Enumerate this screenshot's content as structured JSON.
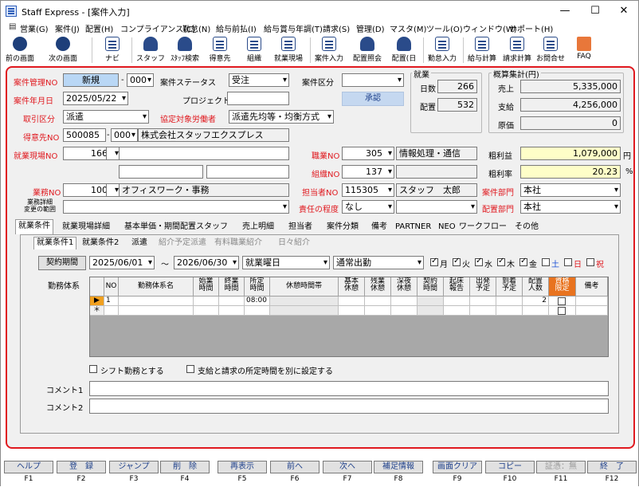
{
  "window": {
    "title": "Staff Express - [案件入力]",
    "min": "—",
    "max": "☐",
    "close": "✕"
  },
  "menu": [
    "営業(G)",
    "案件(J)",
    "配置(H)",
    "コンプライアンス(C)",
    "勤怠(N)",
    "給与前払(I)",
    "給与賞与年調(T)",
    "請求(S)",
    "管理(D)",
    "マスタ(M)",
    "ツール(O)",
    "ウィンドウ(W)",
    "サポート(H)"
  ],
  "toolbar": [
    "前の画面",
    "次の画面",
    "ナビ",
    "スタッフ",
    "ｽﾀｯﾌ検索",
    "得意先",
    "組織",
    "就業現場",
    "案件入力",
    "配置照会",
    "配置(日",
    "勤怠入力",
    "給与計算",
    "請求計算",
    "お問合せ",
    "FAQ"
  ],
  "case": {
    "no_label": "案件管理NO",
    "no_value": "新規",
    "no_dash": "-",
    "no_sub": "000",
    "status_label": "案件ステータス",
    "status_value": "受注",
    "kubun_label": "案件区分",
    "kubun_value": "",
    "date_label": "案件年月日",
    "date_value": "2025/05/22",
    "project_label": "プロジェクトNO",
    "project_value": "",
    "approve_label": "承認",
    "torihiki_label": "取引区分",
    "torihiki_value": "派遣",
    "kyotei_label": "協定対象労働者",
    "kyotei_value": "派遣先均等・均衡方式",
    "tokui_label": "得意先NO",
    "tokui_value": "500085",
    "tokui_sub": "000",
    "tokui_name": "株式会社スタッフエクスプレス",
    "genba_label": "就業現場NO",
    "genba_value": "166",
    "shokugyo_label": "職業NO",
    "shokugyo_value": "305",
    "shokugyo_name": "情報処理・通信",
    "soshiki_label": "組織NO",
    "soshiki_value": "137",
    "gyomu_label": "業務NO",
    "gyomu_value": "100",
    "gyomu_name": "オフィスワーク・事務",
    "tanto_label": "担当者NO",
    "tanto_value": "115305",
    "tanto_name": "スタッフ　太郎",
    "bumon_label": "案件部門",
    "bumon_value": "本社",
    "henko_label": "業務詳細\n変更の範囲",
    "sekinin_label": "責任の程度",
    "sekinin_value": "なし",
    "haichi_bumon_label": "配置部門",
    "haichi_bumon_value": "本社"
  },
  "shugyo": {
    "title": "就業",
    "days_label": "日数",
    "days": "266",
    "haichi_label": "配置",
    "haichi": "532"
  },
  "summary": {
    "title": "概算集計(円)",
    "sales_label": "売上",
    "sales": "5,335,000",
    "pay_label": "支給",
    "pay": "4,256,000",
    "cost_label": "原価",
    "cost": "0",
    "profit_label": "粗利益",
    "profit": "1,079,000",
    "profit_unit": "円",
    "rate_label": "粗利率",
    "rate": "20.23",
    "rate_unit": "%"
  },
  "tabs": [
    "就業条件",
    "就業現場詳細",
    "基本単価・期間配置スタッフ",
    "売上明細",
    "担当者",
    "案件分類",
    "備考",
    "PARTNER",
    "NEO",
    "ワークフロー",
    "その他"
  ],
  "subtabs": [
    "就業条件1",
    "就業条件2",
    "派遣",
    "紹介予定派遣",
    "有料職業紹介",
    "日々紹介"
  ],
  "period": {
    "button": "契約期間",
    "start": "2025/06/01",
    "tilde": "～",
    "end": "2026/06/30",
    "day_type": "就業曜日",
    "work_type": "通常出勤",
    "days": [
      {
        "l": "月",
        "on": true
      },
      {
        "l": "火",
        "on": true
      },
      {
        "l": "水",
        "on": true
      },
      {
        "l": "木",
        "on": true
      },
      {
        "l": "金",
        "on": true
      },
      {
        "l": "土",
        "on": false
      },
      {
        "l": "日",
        "on": false
      },
      {
        "l": "祝",
        "on": false
      }
    ]
  },
  "grid": {
    "label": "勤務体系",
    "headers": [
      "NO",
      "勤務体系名",
      "始業\n時間",
      "終業\n時間",
      "所定\n時間",
      "休憩時間帯",
      "基本\n休憩",
      "残業\n休憩",
      "深夜\n休憩",
      "契約\n時間",
      "起床\n報告",
      "出発\n予定",
      "到着\n予定",
      "配置\n人数",
      "資格\n限定",
      "備考"
    ],
    "row1": {
      "no": "1",
      "shotei": "08:00",
      "ninzu": "2"
    },
    "row1_marker": "▶",
    "row2_marker": "＊"
  },
  "options": {
    "shift": "シフト勤務とする",
    "separate": "支給と請求の所定時間を別に設定する"
  },
  "comments": {
    "c1_label": "コメント1",
    "c2_label": "コメント2"
  },
  "fkeys": [
    {
      "l": "ヘルプ",
      "k": "F1"
    },
    {
      "l": "登　録",
      "k": "F2"
    },
    {
      "l": "ジャンプ",
      "k": "F3"
    },
    {
      "l": "削　除",
      "k": "F4"
    },
    {
      "l": "再表示",
      "k": "F5"
    },
    {
      "l": "前へ",
      "k": "F6"
    },
    {
      "l": "次へ",
      "k": "F7"
    },
    {
      "l": "補足情報",
      "k": "F8"
    },
    {
      "l": "画面クリア",
      "k": "F9"
    },
    {
      "l": "コピー",
      "k": "F10"
    },
    {
      "l": "証憑：無",
      "k": "F11"
    },
    {
      "l": "終　了",
      "k": "F12"
    }
  ],
  "colors": {
    "accent_red": "#e0191f",
    "orange": "#e8731f",
    "highlight": "#fefec8"
  }
}
